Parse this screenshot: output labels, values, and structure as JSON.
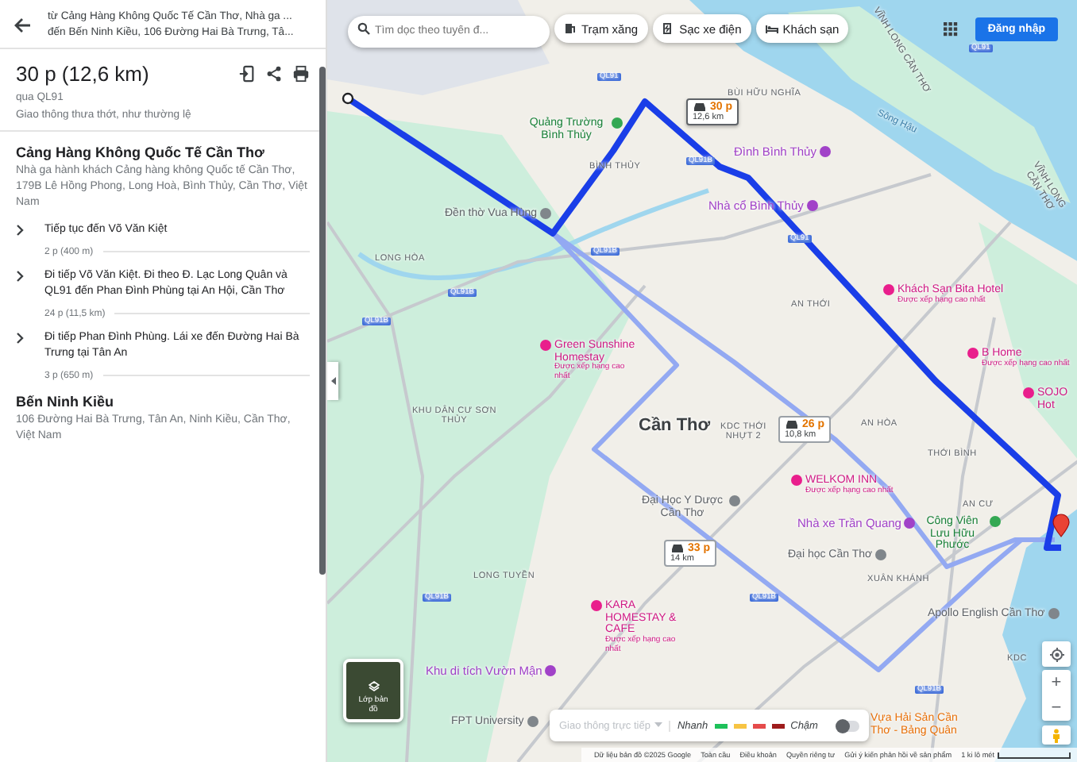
{
  "sidebar": {
    "from": "từ Cảng Hàng Không Quốc Tế Cần Thơ, Nhà ga ...",
    "to": "đến Bến Ninh Kiều, 106 Đường Hai Bà Trưng, Tâ...",
    "summary": {
      "duration": "30 p (12,6 km)",
      "via": "qua QL91",
      "traffic": "Giao thông thưa thớt, như thường lệ"
    },
    "origin": {
      "name": "Cảng Hàng Không Quốc Tế Cần Thơ",
      "address": "Nhà ga hành khách Cảng hàng không Quốc tế Cần Thơ, 179B Lê Hồng Phong, Long Hoà, Bình Thủy, Cần Thơ, Việt Nam"
    },
    "steps": [
      {
        "text": "Tiếp tục đến Võ Văn Kiệt",
        "distance": "2 p (400 m)"
      },
      {
        "text": "Đi tiếp Võ Văn Kiệt. Đi theo Đ. Lạc Long Quân và QL91 đến Phan Đình Phùng tại An Hội, Cần Thơ",
        "distance": "24 p (11,5 km)"
      },
      {
        "text": "Đi tiếp Phan Đình Phùng. Lái xe đến Đường Hai Bà Trưng tại Tân An",
        "distance": "3 p (650 m)"
      }
    ],
    "destination": {
      "name": "Bến Ninh Kiều",
      "address": "106 Đường Hai Bà Trưng, Tân An, Ninh Kiều, Cần Thơ, Việt Nam"
    }
  },
  "map": {
    "search": {
      "placeholder": "Tìm dọc theo tuyến đ..."
    },
    "chips": [
      "Trạm xăng",
      "Sạc xe điện",
      "Khách sạn"
    ],
    "sign_in": "Đăng nhập",
    "routes": [
      {
        "time": "30 p",
        "distance": "12,6 km",
        "selected": true
      },
      {
        "time": "26 p",
        "distance": "10,8 km",
        "selected": false
      },
      {
        "time": "33 p",
        "distance": "14 km",
        "selected": false
      }
    ],
    "labels": [
      {
        "kind": "road",
        "text": "QL91"
      },
      {
        "kind": "boundary",
        "text": "VĨNH LONG CẦN THƠ"
      },
      {
        "kind": "district",
        "text": "BÙI HỮU NGHĨA"
      },
      {
        "kind": "river",
        "text": "Sông Hậu"
      },
      {
        "kind": "boundary",
        "text": "VĨNH LONG CẦN THƠ"
      },
      {
        "kind": "park",
        "text": "Quảng Trường Bình Thủy"
      },
      {
        "kind": "road",
        "text": "QL91"
      },
      {
        "kind": "poi",
        "text": "Đình Bình Thủy"
      },
      {
        "kind": "district",
        "text": "BÌNH THỦY"
      },
      {
        "kind": "road",
        "text": "QL91B"
      },
      {
        "kind": "place",
        "text": "Đền thờ Vua Hùng"
      },
      {
        "kind": "poi",
        "text": "Nhà cổ Bình Thủy"
      },
      {
        "kind": "road",
        "text": "QL91B"
      },
      {
        "kind": "road",
        "text": "QL91"
      },
      {
        "kind": "district",
        "text": "LONG HÒA"
      },
      {
        "kind": "road",
        "text": "QL91B"
      },
      {
        "kind": "road",
        "text": "QL91B"
      },
      {
        "kind": "district",
        "text": "AN THỚI"
      },
      {
        "kind": "hotel",
        "text": "Khách Sạn Bita Hotel",
        "note": "Được xếp hạng cao nhất"
      },
      {
        "kind": "hotel",
        "text": "Green Sunshine Homestay",
        "note": "Được xếp hạng cao nhất"
      },
      {
        "kind": "hotel",
        "text": "B Home",
        "note": "Được xếp hạng cao nhất"
      },
      {
        "kind": "hotel",
        "text": "SOJO Hot"
      },
      {
        "kind": "district",
        "text": "KHU DÂN CƯ SƠN THỦY"
      },
      {
        "kind": "city",
        "text": "Cần Thơ"
      },
      {
        "kind": "district",
        "text": "KDC THỚI NHỰT 2"
      },
      {
        "kind": "district",
        "text": "AN HÒA"
      },
      {
        "kind": "district",
        "text": "THỚI BÌNH"
      },
      {
        "kind": "hotel",
        "text": "WELKOM INN",
        "note": "Được xếp hạng cao nhất"
      },
      {
        "kind": "district",
        "text": "AN CƯ"
      },
      {
        "kind": "place",
        "text": "Đại Học Y Dược Cần Thơ"
      },
      {
        "kind": "poi",
        "text": "Nhà xe Trần Quang"
      },
      {
        "kind": "park",
        "text": "Công Viên Lưu Hữu Phước"
      },
      {
        "kind": "place",
        "text": "Đại học Cần Thơ"
      },
      {
        "kind": "district",
        "text": "LONG TUYỀN"
      },
      {
        "kind": "district",
        "text": "XUÂN KHÁNH"
      },
      {
        "kind": "road",
        "text": "QL91B"
      },
      {
        "kind": "road",
        "text": "QL91B"
      },
      {
        "kind": "hotel",
        "text": "KARA HOMESTAY & CAFE",
        "note": "Được xếp hạng cao nhất"
      },
      {
        "kind": "place",
        "text": "Apollo English Cần Thơ"
      },
      {
        "kind": "district",
        "text": "KDC"
      },
      {
        "kind": "poi",
        "text": "Khu di tích Vườn Mận"
      },
      {
        "kind": "road",
        "text": "QL91B"
      },
      {
        "kind": "place",
        "text": "FPT University"
      },
      {
        "kind": "food",
        "text": "Vựa Hải Sản Cần Thơ - Bảng Quân"
      }
    ],
    "layers": "Lớp bản đồ",
    "traffic": {
      "label": "Giao thông trực tiếp",
      "disabled": true,
      "fast": "Nhanh",
      "slow": "Chậm",
      "on": false,
      "legend": [
        {
          "color": "#1ec15a"
        },
        {
          "color": "#f7c443"
        },
        {
          "color": "#e54b4b"
        },
        {
          "color": "#9e1c1c"
        }
      ]
    },
    "zoom": [
      "+",
      "−"
    ],
    "footer": [
      "Dữ liệu bản đồ ©2025 Google",
      "Toàn cầu",
      "Điều khoản",
      "Quyền riêng tư",
      "Gửi ý kiến phản hồi về sản phẩm",
      "1 ki lô mét"
    ]
  }
}
